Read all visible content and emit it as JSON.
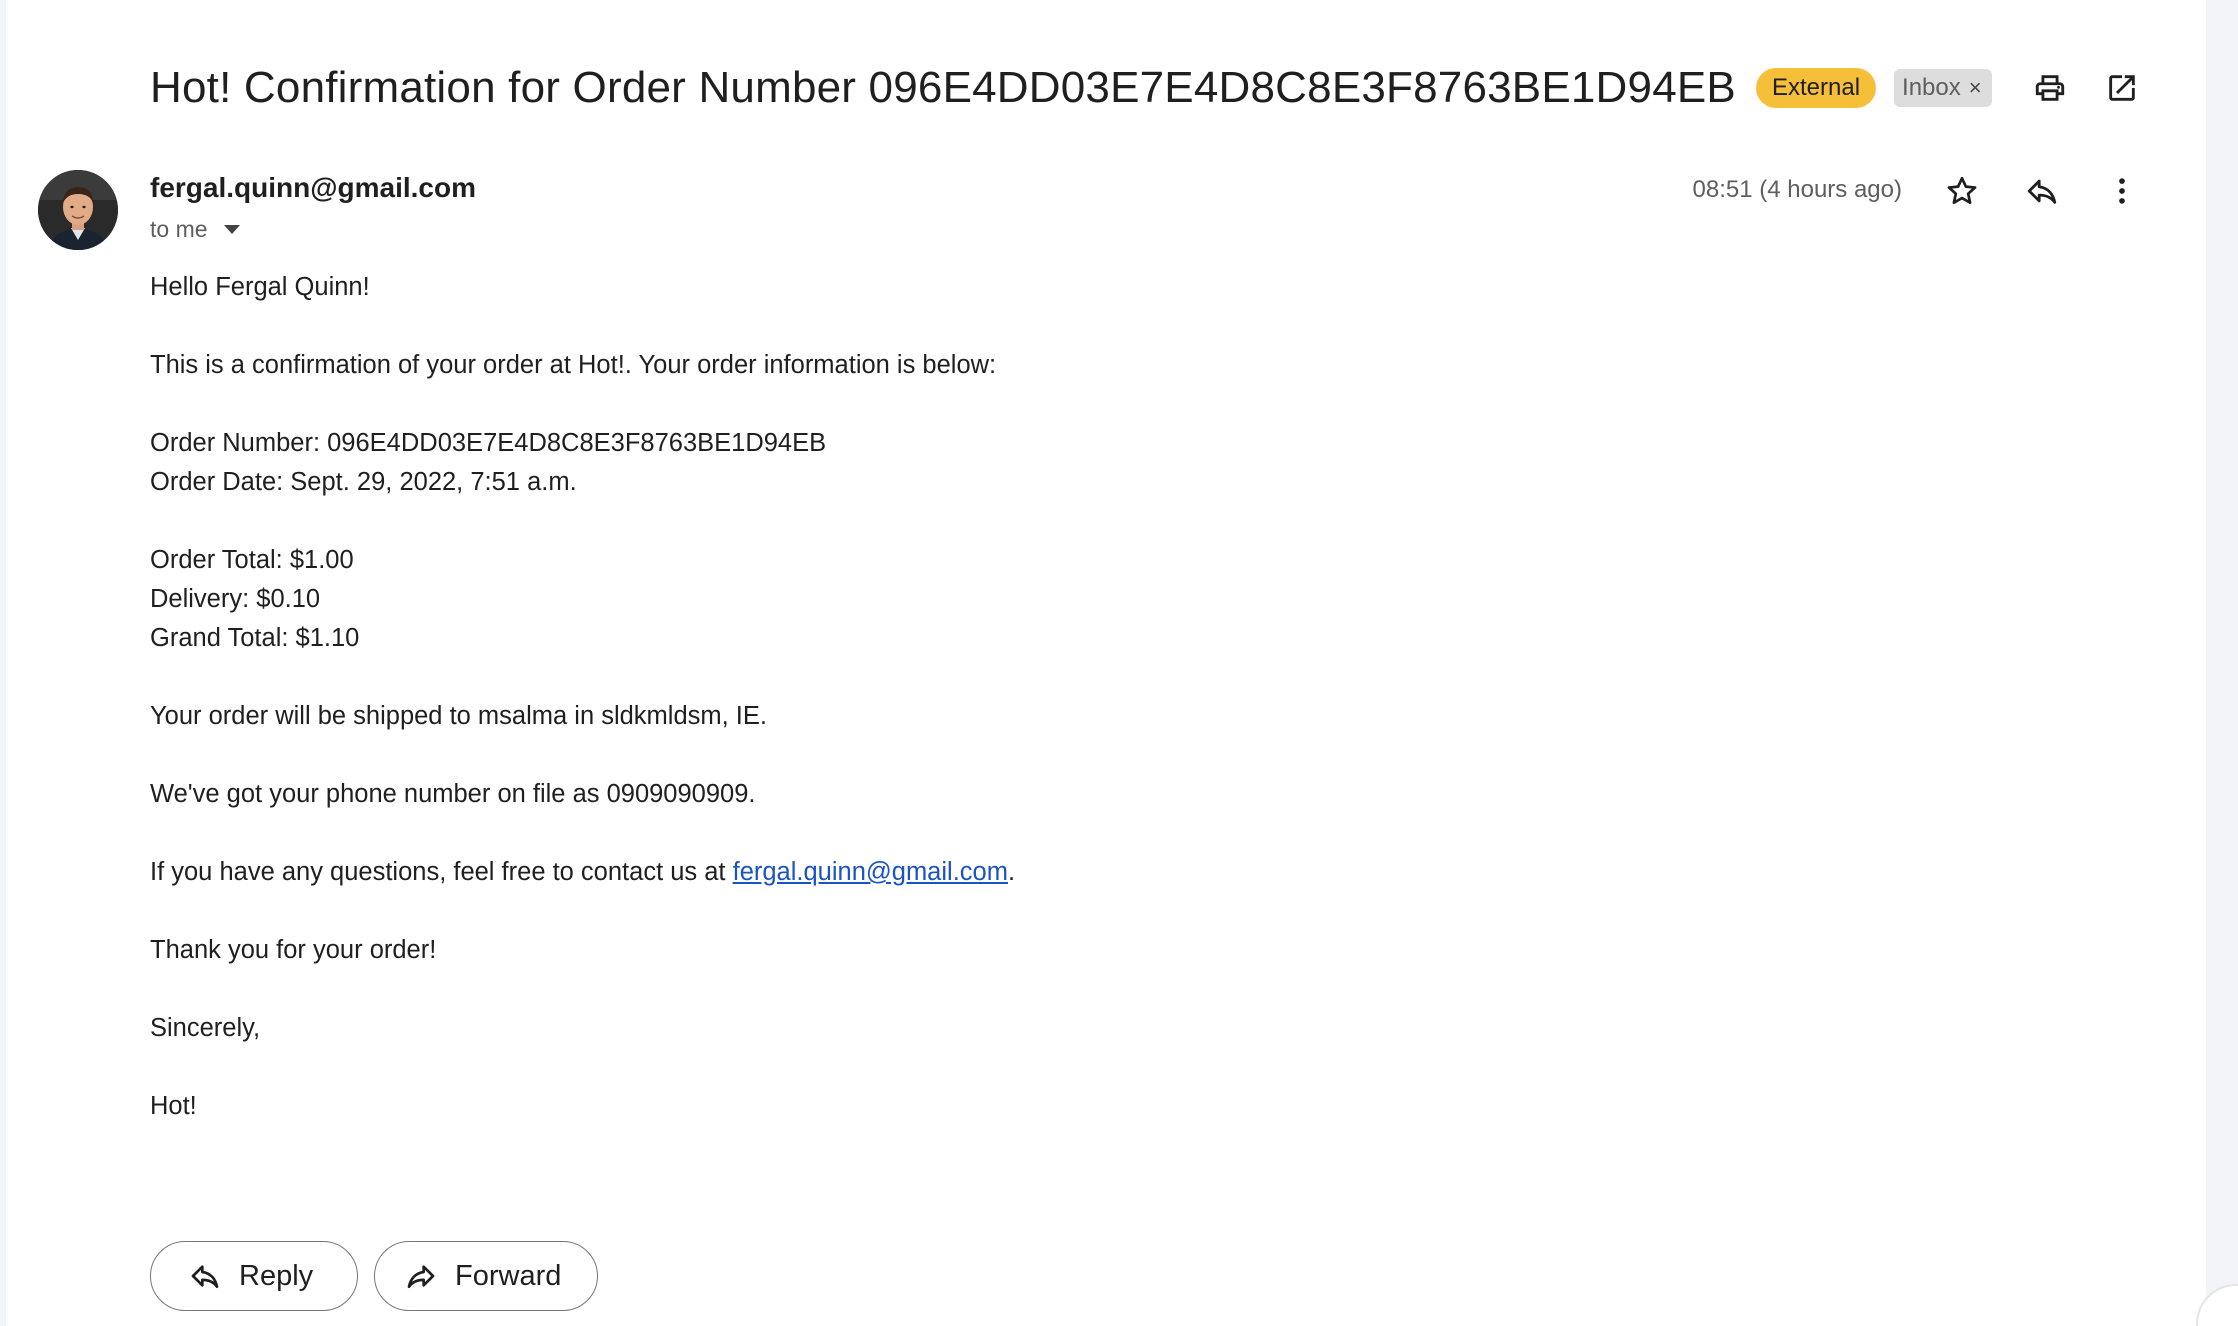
{
  "email": {
    "subject": "Hot! Confirmation for Order Number 096E4DD03E7E4D8C8E3F8763BE1D94EB",
    "labels": {
      "external": "External",
      "inbox": "Inbox",
      "inbox_remove": "×"
    },
    "sender": "fergal.quinn@gmail.com",
    "recipient": "to me",
    "timestamp": "08:51 (4 hours ago)",
    "body": {
      "greeting": "Hello Fergal Quinn!",
      "intro": "This is a confirmation of your order at Hot!. Your order information is below:",
      "order_number": "Order Number: 096E4DD03E7E4D8C8E3F8763BE1D94EB",
      "order_date": "Order Date: Sept. 29, 2022, 7:51 a.m.",
      "order_total": "Order Total: $1.00",
      "delivery": "Delivery: $0.10",
      "grand_total": "Grand Total: $1.10",
      "shipping": "Your order will be shipped to msalma in sldkmldsm, IE.",
      "phone": "We've got your phone number on file as 0909090909.",
      "questions_prefix": "If you have any questions, feel free to contact us at ",
      "contact_email": "fergal.quinn@gmail.com",
      "questions_suffix": ".",
      "thanks": "Thank you for your order!",
      "signoff": "Sincerely,",
      "signature": "Hot!"
    }
  },
  "actions": {
    "reply_label": "Reply",
    "forward_label": "Forward"
  },
  "icons": {
    "print": "print-icon",
    "open_new_window": "open-in-new-window-icon",
    "star": "star-icon",
    "reply": "reply-icon",
    "more": "more-vertical-icon",
    "forward": "forward-icon",
    "avatar": "avatar"
  },
  "colors": {
    "external_label": "#f5bf3a",
    "inbox_label": "#dddddd",
    "link": "#1a53c3"
  }
}
